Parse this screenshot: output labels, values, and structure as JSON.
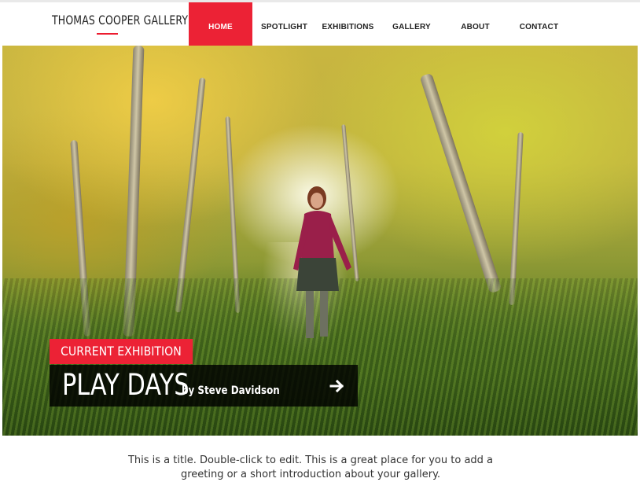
{
  "header": {
    "logo": "THOMAS COOPER GALLERY",
    "nav": [
      {
        "label": "HOME",
        "active": true
      },
      {
        "label": "SPOTLIGHT",
        "active": false
      },
      {
        "label": "EXHIBITIONS",
        "active": false
      },
      {
        "label": "GALLERY",
        "active": false
      },
      {
        "label": "ABOUT",
        "active": false
      },
      {
        "label": "CONTACT",
        "active": false
      }
    ]
  },
  "hero": {
    "tag": "CURRENT EXHIBITION",
    "title": "PLAY DAYS",
    "byline": "by Steve Davidson",
    "arrow_icon": "arrow-right-icon"
  },
  "intro": {
    "text": "This is a title. Double-click to edit. This is a great place for you to add a greeting or a short introduction about your gallery."
  },
  "colors": {
    "accent": "#ec2235",
    "overlay": "#000000"
  }
}
